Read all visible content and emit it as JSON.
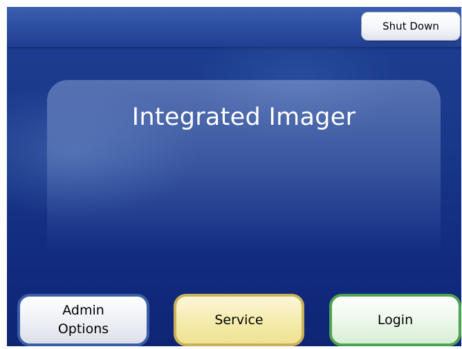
{
  "header": {
    "shutdown_label": "Shut Down"
  },
  "main": {
    "title": "Integrated Imager"
  },
  "footer": {
    "admin_label": "Admin\nOptions",
    "service_label": "Service",
    "login_label": "Login"
  },
  "colors": {
    "background": "#1b3a8c",
    "admin_border": "#3a5ea8",
    "service_border": "#c9b25a",
    "login_border": "#4ea352"
  }
}
